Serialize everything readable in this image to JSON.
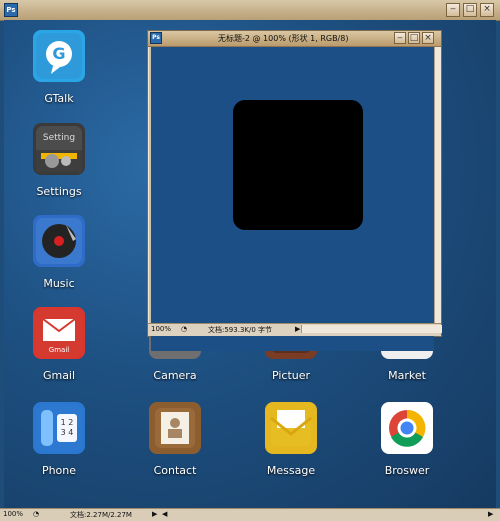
{
  "outer_window": {
    "title": "",
    "statusbar": {
      "zoom": "100%",
      "doc": "文档:2.27M/2.27M"
    }
  },
  "document_window": {
    "title": "无标题-2 @ 100% (形状 1, RGB/8)",
    "statusbar": {
      "zoom": "100%",
      "doc": "文档:593.3K/0 字节"
    }
  },
  "apps": [
    {
      "label": "GTalk",
      "icon": "gtalk-icon"
    },
    {
      "label": "Settings",
      "icon": "settings-icon"
    },
    {
      "label": "Music",
      "icon": "music-icon"
    },
    {
      "label": "Gmail",
      "icon": "gmail-icon"
    },
    {
      "label": "Camera",
      "icon": "camera-icon"
    },
    {
      "label": "Pictuer",
      "icon": "picture-icon"
    },
    {
      "label": "Market",
      "icon": "market-icon"
    },
    {
      "label": "Phone",
      "icon": "phone-icon"
    },
    {
      "label": "Contact",
      "icon": "contact-icon"
    },
    {
      "label": "Message",
      "icon": "message-icon"
    },
    {
      "label": "Broswer",
      "icon": "browser-icon"
    }
  ],
  "colors": {
    "desktop_bg": "#1f4d7a",
    "accent": "#2a6aad"
  }
}
